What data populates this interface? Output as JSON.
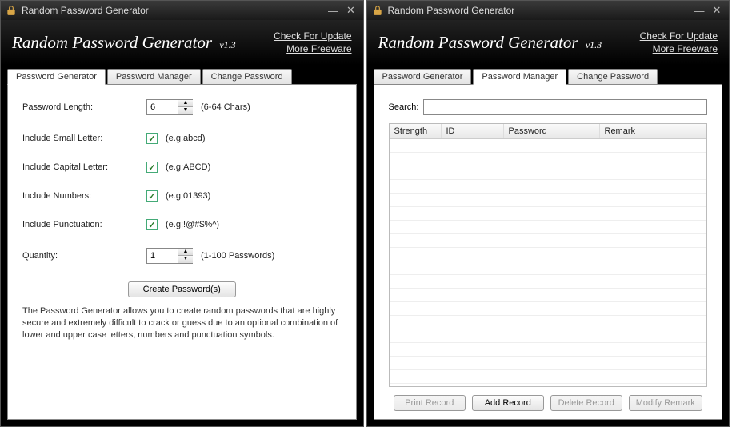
{
  "windows": [
    {
      "titlebar": "Random Password Generator",
      "header_title": "Random Password Generator",
      "version": "v1.3",
      "links": {
        "update": "Check For Update",
        "freeware": "More Freeware"
      },
      "tabs": [
        "Password Generator",
        "Password Manager",
        "Change Password"
      ],
      "active_tab": 0,
      "form": {
        "length_label": "Password Length:",
        "length_value": "6",
        "length_hint": "(6-64 Chars)",
        "small_label": "Include Small Letter:",
        "small_hint": "(e.g:abcd)",
        "small_checked": true,
        "capital_label": "Include Capital Letter:",
        "capital_hint": "(e.g:ABCD)",
        "capital_checked": true,
        "numbers_label": "Include Numbers:",
        "numbers_hint": "(e.g:01393)",
        "numbers_checked": true,
        "punct_label": "Include Punctuation:",
        "punct_hint": "(e.g:!@#$%^)",
        "punct_checked": true,
        "qty_label": "Quantity:",
        "qty_value": "1",
        "qty_hint": "(1-100 Passwords)",
        "create_btn": "Create Password(s)",
        "description": "The Password Generator allows you to create random passwords that are highly secure and extremely difficult to crack or guess due to an optional combination of lower and upper case letters, numbers and punctuation symbols."
      }
    },
    {
      "titlebar": "Random Password Generator",
      "header_title": "Random Password Generator",
      "version": "v1.3",
      "links": {
        "update": "Check For Update",
        "freeware": "More Freeware"
      },
      "tabs": [
        "Password Generator",
        "Password Manager",
        "Change Password"
      ],
      "active_tab": 1,
      "manager": {
        "search_label": "Search:",
        "columns": [
          "Strength",
          "ID",
          "Password",
          "Remark"
        ],
        "rows": [],
        "buttons": {
          "print": {
            "label": "Print Record",
            "enabled": false
          },
          "add": {
            "label": "Add Record",
            "enabled": true
          },
          "delete": {
            "label": "Delete Record",
            "enabled": false
          },
          "modify": {
            "label": "Modify Remark",
            "enabled": false
          }
        }
      }
    }
  ]
}
